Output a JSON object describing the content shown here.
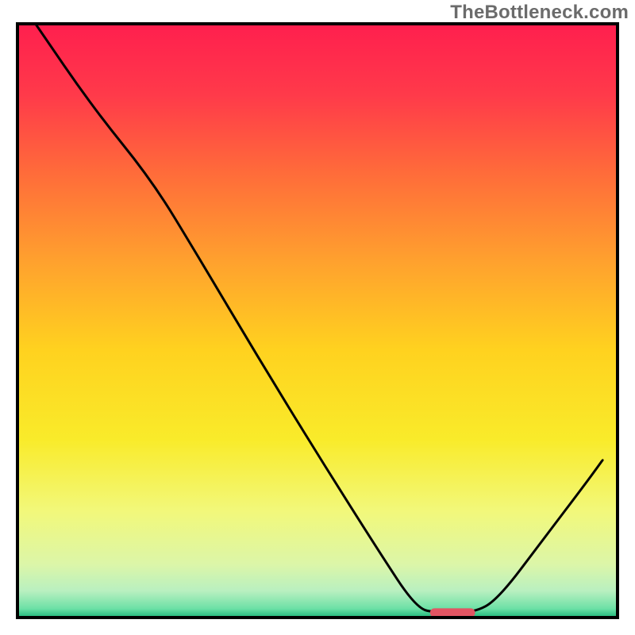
{
  "watermark": "TheBottleneck.com",
  "chart_data": {
    "type": "line",
    "title": "",
    "xlabel": "",
    "ylabel": "",
    "xlim": [
      0,
      100
    ],
    "ylim": [
      0,
      100
    ],
    "note": "Axes have no tick labels; values are percentage estimates from visual position, reading curve height from the plot frame.",
    "curve_points": [
      {
        "x": 3.0,
        "y": 100.0
      },
      {
        "x": 12.5,
        "y": 86.0
      },
      {
        "x": 22.5,
        "y": 73.5
      },
      {
        "x": 30.0,
        "y": 61.0
      },
      {
        "x": 40.0,
        "y": 44.0
      },
      {
        "x": 50.0,
        "y": 27.5
      },
      {
        "x": 60.0,
        "y": 11.5
      },
      {
        "x": 66.5,
        "y": 1.5
      },
      {
        "x": 70.0,
        "y": 0.8
      },
      {
        "x": 76.0,
        "y": 0.8
      },
      {
        "x": 80.0,
        "y": 3.0
      },
      {
        "x": 87.5,
        "y": 13.0
      },
      {
        "x": 95.0,
        "y": 23.0
      },
      {
        "x": 97.5,
        "y": 26.5
      }
    ],
    "gradient_stops": [
      {
        "offset": 0.0,
        "color": "#ff1f4e"
      },
      {
        "offset": 0.12,
        "color": "#ff3a4a"
      },
      {
        "offset": 0.25,
        "color": "#ff6b3a"
      },
      {
        "offset": 0.4,
        "color": "#ffa12e"
      },
      {
        "offset": 0.55,
        "color": "#ffd21f"
      },
      {
        "offset": 0.7,
        "color": "#f9eb2a"
      },
      {
        "offset": 0.82,
        "color": "#f2f87a"
      },
      {
        "offset": 0.91,
        "color": "#dcf6a8"
      },
      {
        "offset": 0.955,
        "color": "#b9f0c0"
      },
      {
        "offset": 0.985,
        "color": "#6ce0a6"
      },
      {
        "offset": 1.0,
        "color": "#1eb67a"
      }
    ],
    "marker": {
      "x": 72.5,
      "y": 0.8,
      "width": 7.5,
      "height": 1.5,
      "color": "#e25563"
    },
    "background": "#ffffff"
  }
}
